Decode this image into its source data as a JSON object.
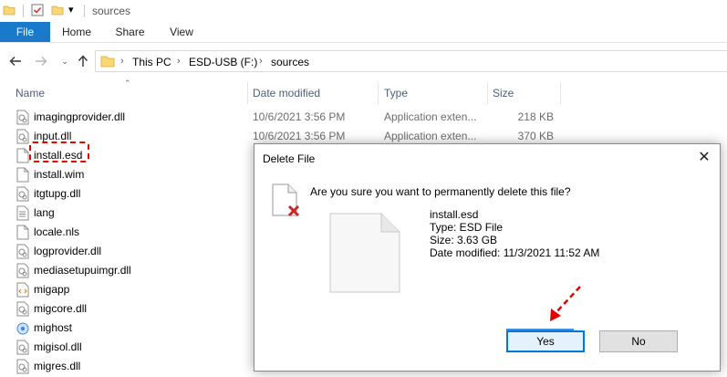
{
  "window": {
    "title": "sources",
    "quick_access_icons": [
      "folder-icon",
      "properties-check-icon",
      "new-folder-icon",
      "customize-dropdown-icon"
    ]
  },
  "ribbon": {
    "tabs": [
      {
        "label": "File"
      },
      {
        "label": "Home"
      },
      {
        "label": "Share"
      },
      {
        "label": "View"
      }
    ]
  },
  "address": {
    "path": [
      "This PC",
      "ESD-USB (F:)",
      "sources"
    ]
  },
  "columns": {
    "name": "Name",
    "date_modified": "Date modified",
    "type": "Type",
    "size": "Size"
  },
  "files": [
    {
      "name": "imagingprovider.dll",
      "date": "10/6/2021 3:56 PM",
      "type": "Application exten...",
      "size": "218 KB",
      "icon": "dll-icon"
    },
    {
      "name": "input.dll",
      "date": "10/6/2021 3:56 PM",
      "type": "Application exten...",
      "size": "370 KB",
      "icon": "dll-icon"
    },
    {
      "name": "install.esd",
      "date": "",
      "type": "",
      "size": "",
      "icon": "blank-file-icon"
    },
    {
      "name": "install.wim",
      "date": "",
      "type": "",
      "size": "",
      "icon": "blank-file-icon"
    },
    {
      "name": "itgtupg.dll",
      "date": "",
      "type": "",
      "size": "",
      "icon": "dll-icon"
    },
    {
      "name": "lang",
      "date": "",
      "type": "",
      "size": "",
      "icon": "text-file-icon"
    },
    {
      "name": "locale.nls",
      "date": "",
      "type": "",
      "size": "",
      "icon": "blank-file-icon"
    },
    {
      "name": "logprovider.dll",
      "date": "",
      "type": "",
      "size": "",
      "icon": "dll-icon"
    },
    {
      "name": "mediasetupuimgr.dll",
      "date": "",
      "type": "",
      "size": "",
      "icon": "dll-icon"
    },
    {
      "name": "migapp",
      "date": "",
      "type": "",
      "size": "",
      "icon": "xml-file-icon"
    },
    {
      "name": "migcore.dll",
      "date": "",
      "type": "",
      "size": "",
      "icon": "dll-icon"
    },
    {
      "name": "mighost",
      "date": "",
      "type": "",
      "size": "",
      "icon": "app-icon"
    },
    {
      "name": "migisol.dll",
      "date": "",
      "type": "",
      "size": "",
      "icon": "dll-icon"
    },
    {
      "name": "migres.dll",
      "date": "",
      "type": "",
      "size": "",
      "icon": "dll-icon"
    }
  ],
  "highlight": {
    "color": "#e00000",
    "target": "install.esd"
  },
  "dialog": {
    "title": "Delete File",
    "question": "Are you sure you want to permanently delete this file?",
    "file_name": "install.esd",
    "file_type": "Type: ESD File",
    "file_size": "Size: 3.63 GB",
    "file_date": "Date modified: 11/3/2021 11:52 AM",
    "yes_label": "Yes",
    "no_label": "No"
  },
  "colors": {
    "accent": "#1979ca",
    "column_header": "#4c607a",
    "secondary_text": "#6d6d6d",
    "annotation_red": "#e00000"
  }
}
